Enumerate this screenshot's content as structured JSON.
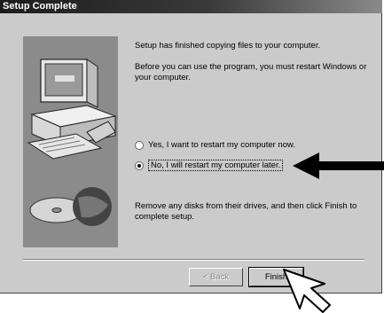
{
  "window": {
    "title": "Setup Complete"
  },
  "message": {
    "line1": "Setup has finished copying files to your computer.",
    "line2a": "Before you can use the program, you must restart Windows or",
    "line2b": "your computer.",
    "remove_a": "Remove any disks from their drives, and then click Finish to",
    "remove_b": "complete setup."
  },
  "options": [
    {
      "label": "Yes, I want to restart my computer now.",
      "checked": false
    },
    {
      "label": "No, I will restart my computer later.",
      "checked": true
    }
  ],
  "buttons": {
    "back": "< Back",
    "finish": "Finish"
  }
}
